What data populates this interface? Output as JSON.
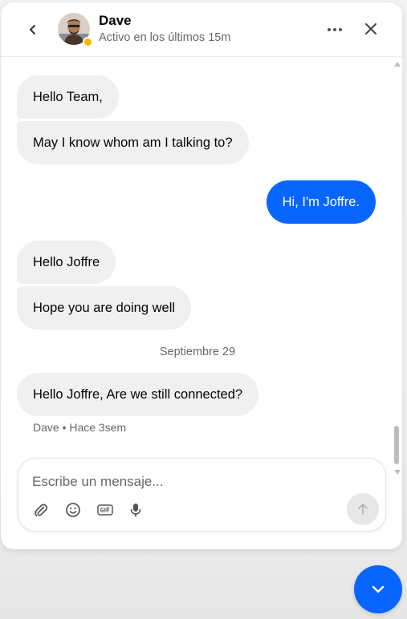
{
  "header": {
    "name": "Dave",
    "status": "Activo en los últimos 15m",
    "status_color": "#f5b700",
    "icons": [
      "chevron-left-icon",
      "more-icon",
      "close-icon"
    ]
  },
  "messages": [
    {
      "direction": "in",
      "text": "Hello Team,"
    },
    {
      "direction": "in",
      "text": "May I know whom am I talking to?"
    },
    {
      "direction": "out",
      "text": "Hi, I'm Joffre."
    },
    {
      "direction": "in",
      "text": "Hello Joffre"
    },
    {
      "direction": "in",
      "text": "Hope you are doing well"
    },
    {
      "direction": "in",
      "text": "Hello Joffre, Are we still connected?"
    }
  ],
  "date_separator": "Septiembre 29",
  "last_meta": "Dave • Hace 3sem",
  "composer": {
    "placeholder": "Escribe un mensaje...",
    "tools": [
      "attach-icon",
      "emoji-icon",
      "gif-icon",
      "microphone-icon"
    ],
    "send_icon": "arrow-up-icon"
  },
  "colors": {
    "accent": "#0866ff",
    "bubble_in": "#f0f0f0",
    "text_secondary": "#65676b"
  }
}
